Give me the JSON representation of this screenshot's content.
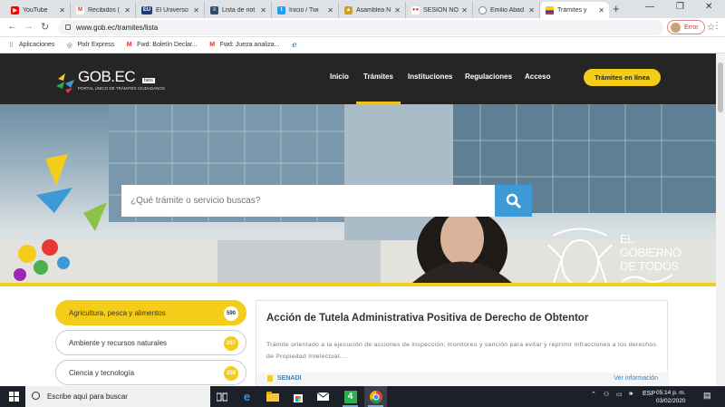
{
  "browser": {
    "tabs": [
      {
        "title": "YouTube",
        "icon": "youtube-icon",
        "color": "#ff0000"
      },
      {
        "title": "Recibidos (",
        "icon": "gmail-icon",
        "color": "#d93025"
      },
      {
        "title": "El Universo",
        "icon": "eu-icon",
        "color": "#1a3e7c"
      },
      {
        "title": "Lista de not",
        "icon": "list-icon",
        "color": "#2b4d6b"
      },
      {
        "title": "Inicio / Twi",
        "icon": "twitter-icon",
        "color": "#1da1f2"
      },
      {
        "title": "Asamblea N",
        "icon": "asamblea-icon",
        "color": "#c9a227"
      },
      {
        "title": "SESIÓN NO",
        "icon": "meet-icon",
        "color": "#3b5bdb"
      },
      {
        "title": "Emilio Abad",
        "icon": "site-icon",
        "color": "#888888"
      },
      {
        "title": "Trámites y",
        "icon": "ecuador-flag-icon",
        "color": "#f4cd1b",
        "active": true
      }
    ],
    "new_tab": "+",
    "url": "www.gob.ec/tramites/lista",
    "profile_label": "Error",
    "bookmarks": [
      {
        "label": "Aplicaciones",
        "icon": "apps-grid-icon"
      },
      {
        "label": "Pixlr Express",
        "icon": "pixlr-icon"
      },
      {
        "label": "Fwd: Boletín Declar...",
        "icon": "gmail-icon"
      },
      {
        "label": "Fwd: Jueza analiza...",
        "icon": "gmail-icon"
      },
      {
        "label": "",
        "icon": "edge-icon"
      }
    ]
  },
  "site": {
    "logo": {
      "main": "GOB.EC",
      "badge": "beta",
      "sub": "PORTAL ÚNICO DE TRÁMITES CIUDADANOS"
    },
    "nav": [
      "Inicio",
      "Trámites",
      "Instituciones",
      "Regulaciones",
      "Acceso"
    ],
    "cta": "Trámites en línea",
    "search_placeholder": "¿Qué trámite o servicio buscas?",
    "gov_text": [
      "EL",
      "GOBIERNO",
      "DE TODOS"
    ],
    "categories": [
      {
        "label": "Agricultura, pesca y alimentos",
        "count": "590",
        "active": true
      },
      {
        "label": "Ambiente y recursos naturales",
        "count": "267",
        "active": false
      },
      {
        "label": "Ciencia y tecnología",
        "count": "258",
        "active": false
      }
    ],
    "card": {
      "title": "Acción de Tutela Administrativa Positiva de Derecho de Obtentor",
      "description": "Trámite orientado a la ejecución de acciones de inspección, monitoreo y sanción para evitar y reprimir infracciones a los derechos de Propiedad Intelectual....",
      "institution": "SENADI",
      "more": "Ver información"
    }
  },
  "taskbar": {
    "search_text": "Escribe aquí para buscar",
    "lang": "ESP",
    "time": "05:14 p. m.",
    "date": "03/02/2020",
    "colors": {
      "accent": "#f4cd1b",
      "dark": "#252525",
      "blue": "#3d9ad6"
    }
  }
}
